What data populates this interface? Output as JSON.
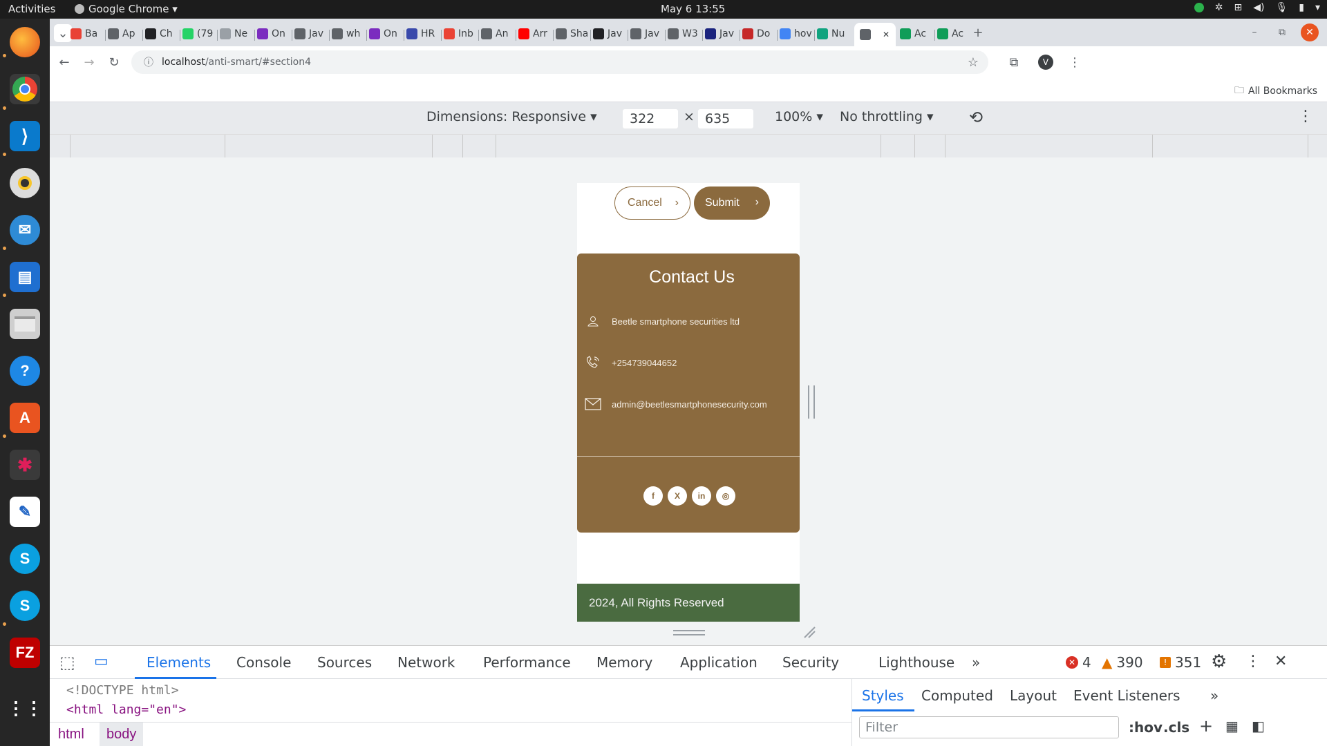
{
  "system": {
    "activities": "Activities",
    "app_name": "Google Chrome ▾",
    "clock": "May 6  13:55"
  },
  "tabs": [
    {
      "label": "Ba",
      "color": "#e94235"
    },
    {
      "label": "Ap",
      "color": "#5f6368"
    },
    {
      "label": "Ch",
      "color": "#202124"
    },
    {
      "label": "(79",
      "color": "#25d366"
    },
    {
      "label": "Ne",
      "color": "#9aa0a6"
    },
    {
      "label": "On",
      "color": "#7b2cbf"
    },
    {
      "label": "Jav",
      "color": "#5f6368"
    },
    {
      "label": "wh",
      "color": "#5f6368"
    },
    {
      "label": "On",
      "color": "#7b2cbf"
    },
    {
      "label": "HR",
      "color": "#3949ab"
    },
    {
      "label": "Inb",
      "color": "#ea4335"
    },
    {
      "label": "An",
      "color": "#5f6368"
    },
    {
      "label": "Arr",
      "color": "#ff0000"
    },
    {
      "label": "Sha",
      "color": "#5f6368"
    },
    {
      "label": "Jav",
      "color": "#202124"
    },
    {
      "label": "Jav",
      "color": "#5f6368"
    },
    {
      "label": "W3",
      "color": "#5f6368"
    },
    {
      "label": "Jav",
      "color": "#1a237e"
    },
    {
      "label": "Do",
      "color": "#c62828"
    },
    {
      "label": "hov",
      "color": "#4285f4"
    },
    {
      "label": "Nu",
      "color": "#10a37f"
    },
    {
      "label": "",
      "color": "#5f6368"
    },
    {
      "label": "Ac",
      "color": "#0f9d58"
    },
    {
      "label": "Ac",
      "color": "#0f9d58"
    }
  ],
  "address": {
    "host": "localhost",
    "path": "/anti-smart/#section4"
  },
  "bookmarks": {
    "all_label": "All Bookmarks"
  },
  "device_toolbar": {
    "dimensions": "Dimensions: Responsive ▾",
    "width": "322",
    "times": "×",
    "height": "635",
    "zoom": "100% ▾",
    "throttling": "No throttling ▾"
  },
  "page": {
    "cancel_label": "Cancel",
    "submit_label": "Submit",
    "arrow": "›",
    "contact_title": "Contact Us",
    "company": "Beetle smartphone securities ltd",
    "phone": "+254739044652",
    "email": "admin@beetlesmartphonesecurity.com",
    "social": [
      "f",
      "X",
      "in",
      "◎"
    ],
    "footer": "2024, All Rights Reserved"
  },
  "devtools": {
    "tabs": [
      "Elements",
      "Console",
      "Sources",
      "Network",
      "Performance",
      "Memory",
      "Application",
      "Security",
      "Lighthouse"
    ],
    "more": "»",
    "errors": "4",
    "warnings": "390",
    "issues": "351",
    "line1": "<!DOCTYPE html>",
    "line2": "<html lang=\"en\">",
    "crumbs": [
      "html",
      "body"
    ],
    "styles_tabs": [
      "Styles",
      "Computed",
      "Layout",
      "Event Listeners"
    ],
    "filter_placeholder": "Filter",
    "hov": ":hov",
    "cls": ".cls"
  },
  "colors": {
    "brand_brown": "#8b6a3e",
    "footer_green": "#4a6b40",
    "devtools_blue": "#1a73e8"
  }
}
